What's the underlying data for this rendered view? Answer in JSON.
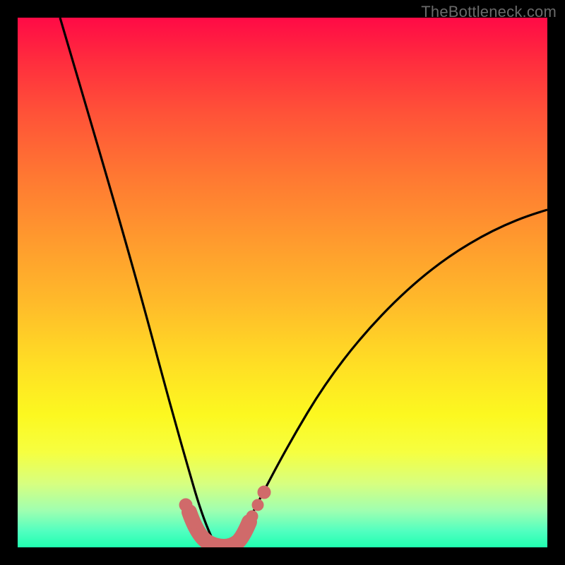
{
  "watermark": "TheBottleneck.com",
  "chart_data": {
    "type": "line",
    "title": "",
    "xlabel": "",
    "ylabel": "",
    "xlim": [
      0,
      100
    ],
    "ylim": [
      0,
      100
    ],
    "series": [
      {
        "name": "left-curve",
        "x": [
          8,
          12,
          16,
          20,
          24,
          28,
          30,
          32,
          33,
          34,
          35,
          36,
          37
        ],
        "values": [
          100,
          80,
          62,
          46,
          32,
          20,
          14,
          9,
          6,
          4,
          2.5,
          1.2,
          0.5
        ]
      },
      {
        "name": "right-curve",
        "x": [
          40,
          41,
          42,
          44,
          48,
          56,
          64,
          72,
          80,
          88,
          96,
          100
        ],
        "values": [
          0.5,
          1.2,
          2.4,
          5,
          10,
          20,
          30,
          39,
          47,
          54,
          60,
          63
        ]
      },
      {
        "name": "bottleneck-markers",
        "x": [
          31.5,
          33,
          34,
          35,
          36,
          37,
          38,
          39,
          40,
          41,
          42.5
        ],
        "values": [
          8,
          3.5,
          2.2,
          1.2,
          0.7,
          0.5,
          0.5,
          0.7,
          1.2,
          2.8,
          6
        ]
      }
    ],
    "marker_color": "#d06a6a",
    "curve_color": "#000000"
  }
}
